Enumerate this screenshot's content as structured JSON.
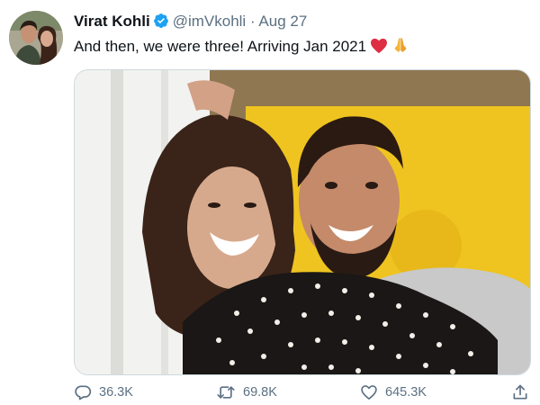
{
  "tweet": {
    "author_name": "Virat Kohli",
    "handle": "@imVkohli",
    "separator": "·",
    "date": "Aug 27",
    "text": "And then, we were three! Arriving Jan 2021",
    "emojis": [
      "red-heart-icon",
      "folded-hands-icon"
    ]
  },
  "actions": {
    "replies": "36.3K",
    "retweets": "69.8K",
    "likes": "645.3K"
  },
  "colors": {
    "text": "#0f1419",
    "muted": "#5b7083",
    "verified": "#1da1f2",
    "heart": "#e0245e"
  }
}
